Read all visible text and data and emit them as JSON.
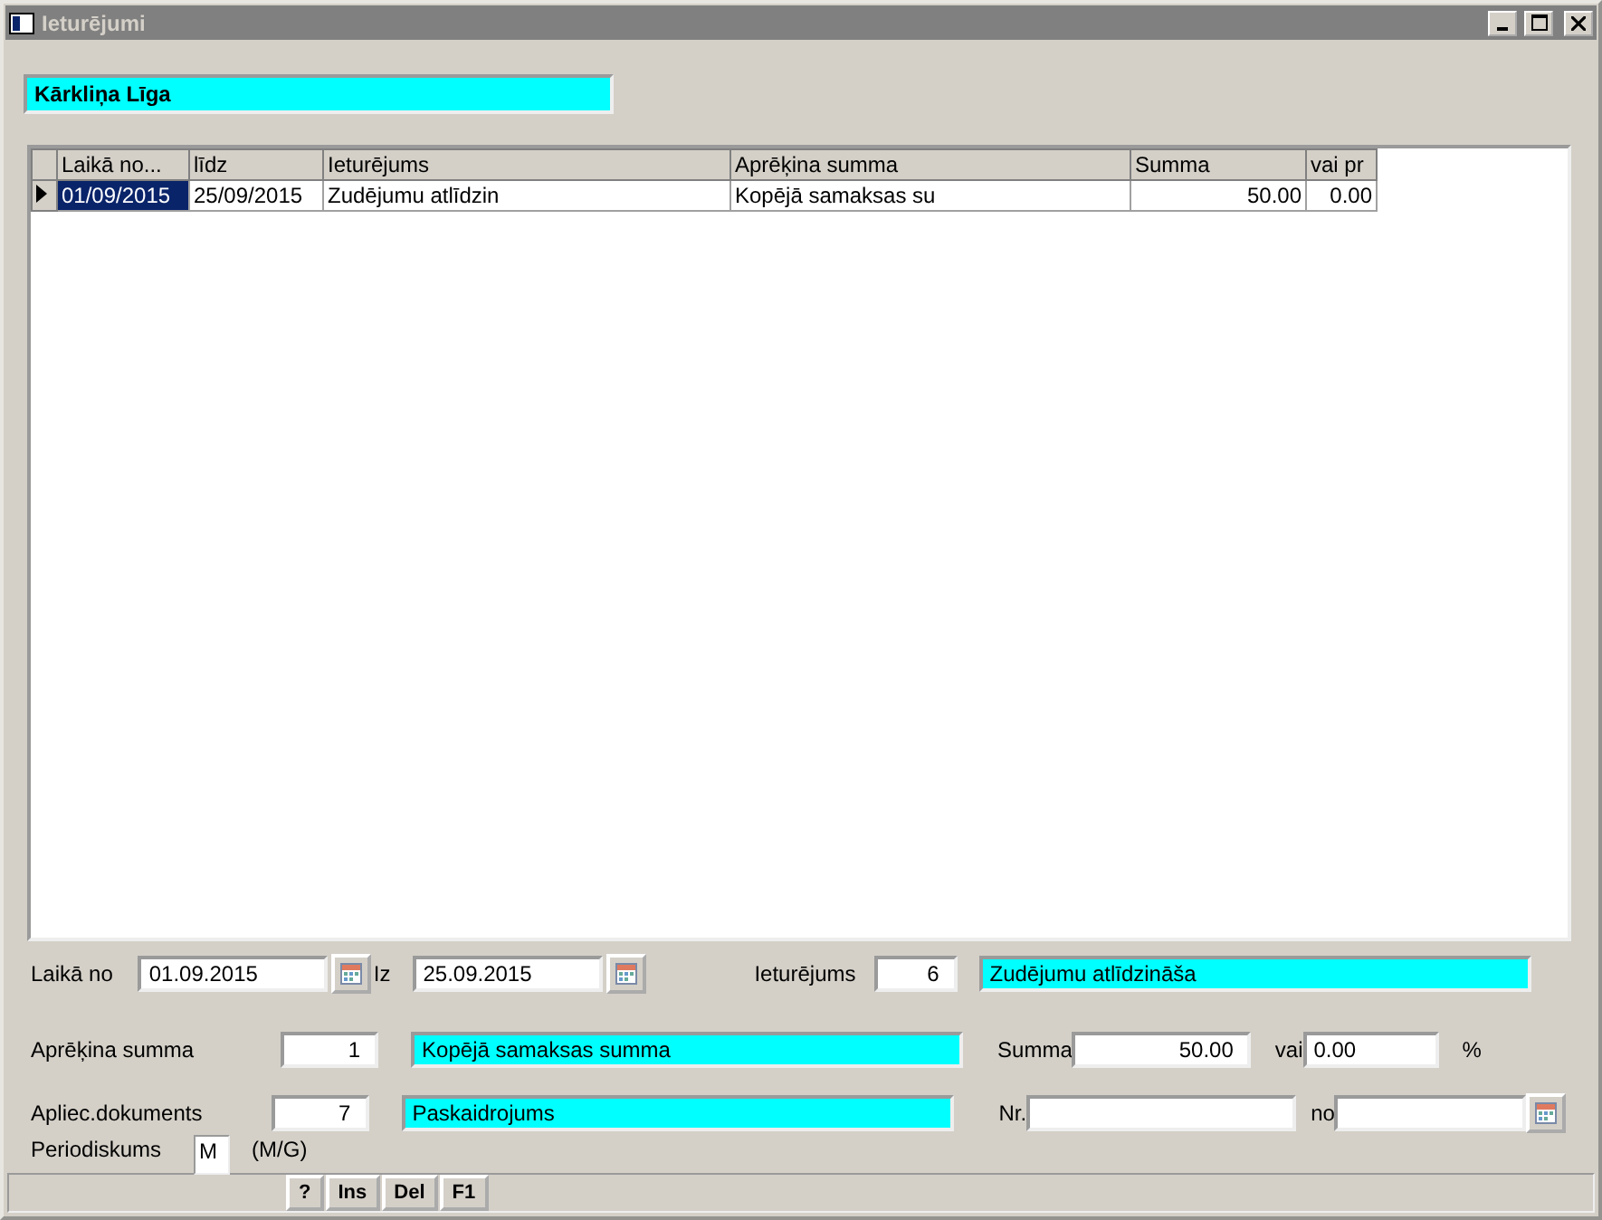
{
  "window": {
    "title": "Ieturējumi"
  },
  "person_name": "Kārkliņa Līga",
  "table": {
    "columns": [
      "Laikā no...",
      "līdz",
      "Ieturējums",
      "Aprēķina summa",
      "Summa",
      "vai pr"
    ],
    "rows": [
      {
        "selected": true,
        "cells": [
          "01/09/2015",
          "25/09/2015",
          "Zudējumu atlīdzin",
          "Kopējā samaksas su",
          "50.00",
          "0.00"
        ]
      }
    ]
  },
  "form": {
    "from_label": "Laikā no",
    "from_value": "01.09.2015",
    "to_label": "Iz",
    "to_value": "25.09.2015",
    "deduction_label": "Ieturējums",
    "deduction_code": "6",
    "deduction_name": "Zudējumu atlīdzināša",
    "calc_label": "Aprēķina summa",
    "calc_code": "1",
    "calc_name": "Kopējā samaksas summa",
    "sum_label": "Summa",
    "sum_value": "50.00",
    "or_label": "vai",
    "percent_value": "0.00",
    "percent_label": "%",
    "doc_label": "Apliec.dokuments",
    "doc_code": "7",
    "doc_name": "Paskaidrojums",
    "nr_label": "Nr.",
    "no_label": "no",
    "period_label": "Periodiskums",
    "period_value": "M",
    "period_hint": "(M/G)"
  },
  "status_buttons": [
    "?",
    "Ins",
    "Del",
    "F1"
  ]
}
